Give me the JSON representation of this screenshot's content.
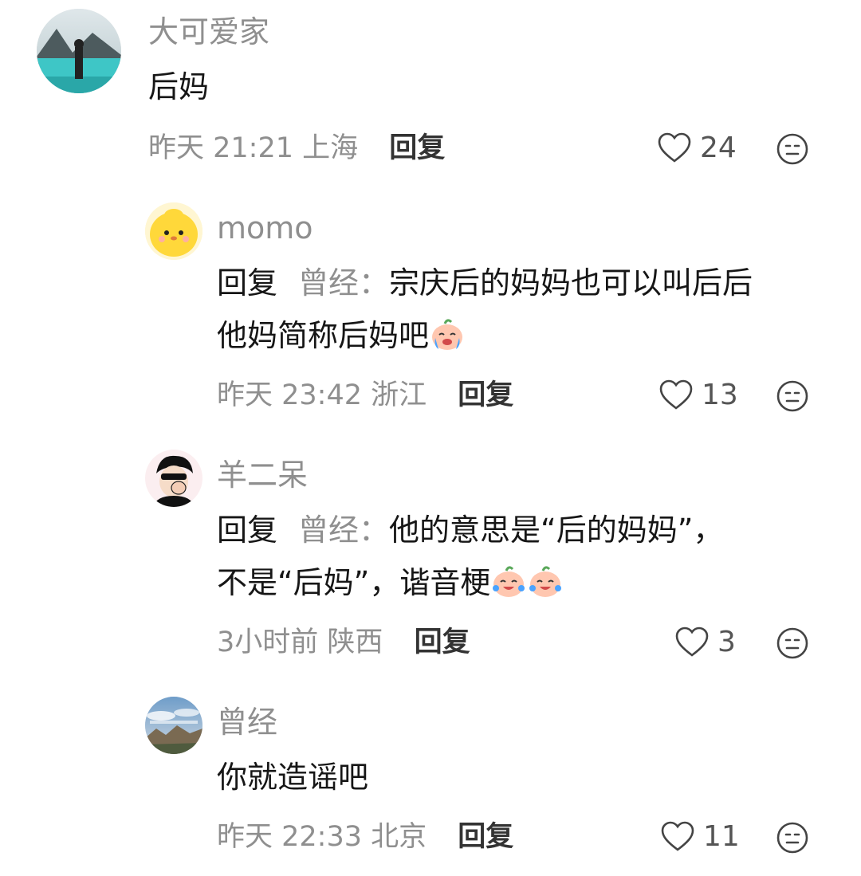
{
  "comments": [
    {
      "author": "大可爱家",
      "text": "后妈",
      "time": "昨天 21:21",
      "location": "上海",
      "reply_label": "回复",
      "likes": "24"
    },
    {
      "author": "momo",
      "reply_prefix": "回复",
      "reply_to": "曾经：",
      "text_line1": "宗庆后的妈妈也可以叫后后",
      "text_line2": "他妈简称后妈吧",
      "time": "昨天 23:42",
      "location": "浙江",
      "reply_label": "回复",
      "likes": "13"
    },
    {
      "author": "羊二呆",
      "reply_prefix": "回复",
      "reply_to": "曾经：",
      "text_line1": "他的意思是“后的妈妈”，",
      "text_line2": "不是“后妈”，谐音梗",
      "time": "3小时前",
      "location": "陕西",
      "reply_label": "回复",
      "likes": "3"
    },
    {
      "author": "曾经",
      "text": "你就造谣吧",
      "time": "昨天 22:33",
      "location": "北京",
      "reply_label": "回复",
      "likes": "11"
    }
  ],
  "colors": {
    "secondary_text": "#8f8f8f",
    "primary_text": "#161616"
  }
}
